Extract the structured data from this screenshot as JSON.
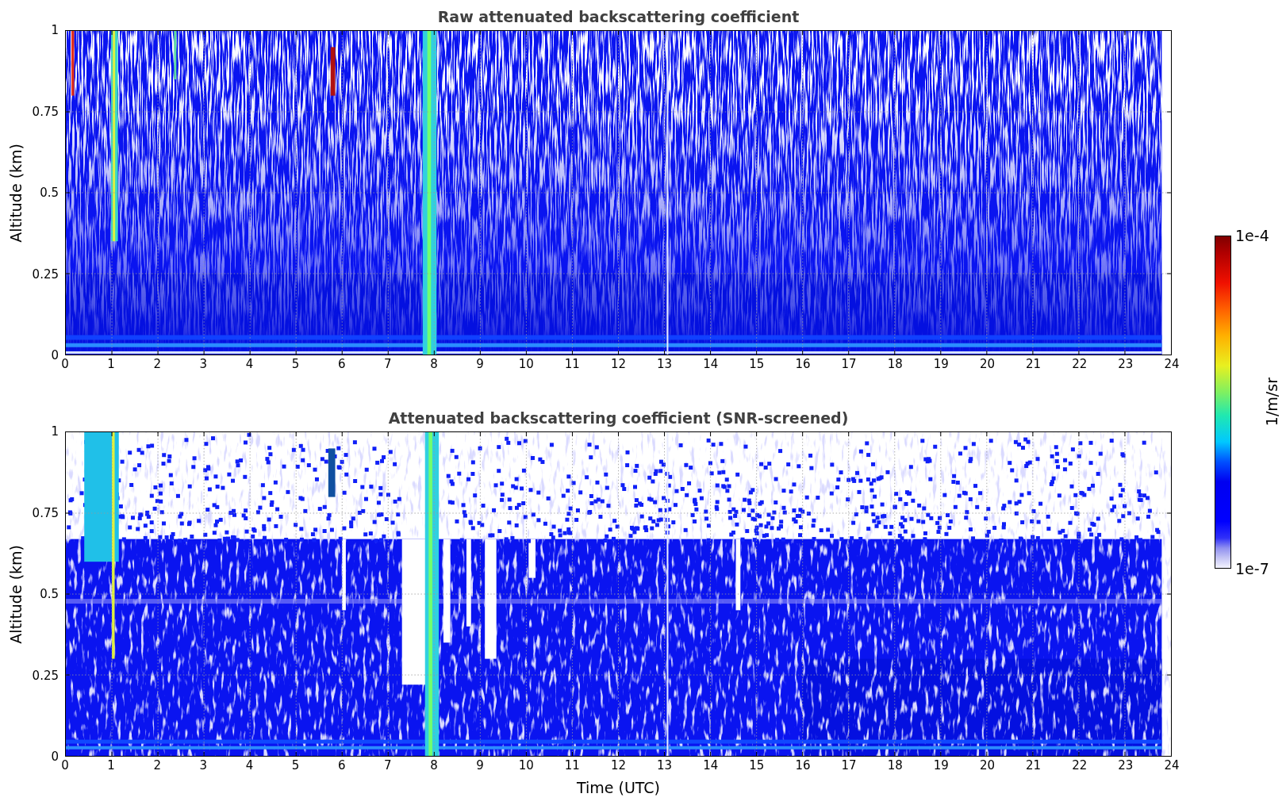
{
  "panels": [
    {
      "kind": "raw",
      "title": "Raw attenuated backscattering coefficient",
      "ylabel": "Altitude (km)",
      "yticks": [
        "1",
        "0.75",
        "0.5",
        "0.25",
        "0"
      ],
      "xticks": [
        "0",
        "1",
        "2",
        "3",
        "4",
        "5",
        "6",
        "7",
        "8",
        "9",
        "10",
        "11",
        "12",
        "13",
        "14",
        "15",
        "16",
        "17",
        "18",
        "19",
        "20",
        "21",
        "22",
        "23",
        "24"
      ]
    },
    {
      "kind": "screened",
      "title": "Attenuated backscattering coefficient (SNR-screened)",
      "ylabel": "Altitude (km)",
      "yticks": [
        "1",
        "0.75",
        "0.5",
        "0.25",
        "0"
      ],
      "xticks": [
        "0",
        "1",
        "2",
        "3",
        "4",
        "5",
        "6",
        "7",
        "8",
        "9",
        "10",
        "11",
        "12",
        "13",
        "14",
        "15",
        "16",
        "17",
        "18",
        "19",
        "20",
        "21",
        "22",
        "23",
        "24"
      ]
    }
  ],
  "xlabel": "Time (UTC)",
  "colorbar": {
    "label": "1/m/sr",
    "max": "1e-4",
    "min": "1e-7"
  }
}
